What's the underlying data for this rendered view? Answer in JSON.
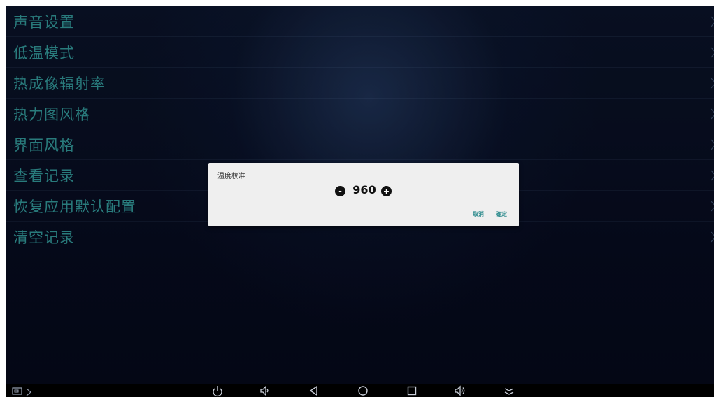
{
  "menu": {
    "items": [
      {
        "label": "声音设置"
      },
      {
        "label": "低温模式"
      },
      {
        "label": "热成像辐射率"
      },
      {
        "label": "热力图风格"
      },
      {
        "label": "界面风格"
      },
      {
        "label": "查看记录"
      },
      {
        "label": "恢复应用默认配置"
      },
      {
        "label": "清空记录"
      }
    ]
  },
  "dialog": {
    "title": "温度校准",
    "value": "960",
    "decrement_label": "-",
    "increment_label": "+",
    "cancel_label": "取消",
    "confirm_label": "确定"
  },
  "colors": {
    "menu_text": "#2f8c8e",
    "background": "#05091a",
    "dialog_bg": "#efefef",
    "accent": "#2f8c8e"
  },
  "navbar": {
    "icons": [
      "screenshot-icon",
      "cast-icon",
      "power-icon",
      "volume-down-icon",
      "back-icon",
      "home-icon",
      "recents-icon",
      "volume-up-icon",
      "collapse-icon"
    ]
  }
}
